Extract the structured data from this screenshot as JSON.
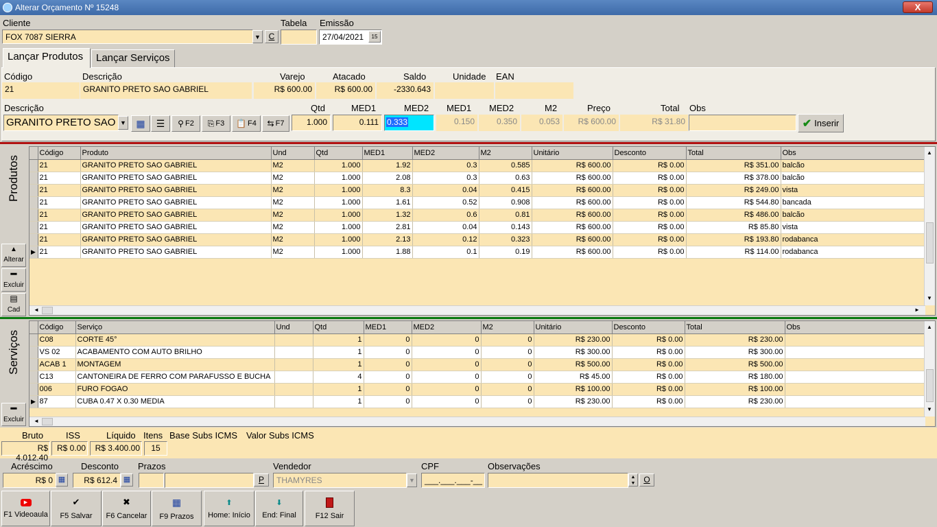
{
  "window": {
    "title": "Alterar Orçamento Nº 15248",
    "close_label": "X"
  },
  "header": {
    "cliente_label": "Cliente",
    "cliente_value": "FOX 7087 SIERRA",
    "c_btn": "C",
    "tabela_label": "Tabela",
    "tabela_value": "",
    "emissao_label": "Emissão",
    "emissao_value": "27/04/2021",
    "cal_btn": "15"
  },
  "tabs": {
    "produtos": "Lançar Produtos",
    "servicos": "Lançar Serviços"
  },
  "product_info": {
    "codigo_label": "Código",
    "codigo": "21",
    "descricao_label": "Descrição",
    "descricao": "GRANITO PRETO SAO GABRIEL",
    "varejo_label": "Varejo",
    "varejo": "R$ 600.00",
    "atacado_label": "Atacado",
    "atacado": "R$ 600.00",
    "saldo_label": "Saldo",
    "saldo": "-2330.643",
    "unidade_label": "Unidade",
    "unidade": "",
    "ean_label": "EAN",
    "ean": ""
  },
  "entry": {
    "descricao_label": "Descrição",
    "descricao_value": "GRANITO PRETO SAO",
    "f2": "F2",
    "f3": "F3",
    "f4": "F4",
    "f7": "F7",
    "qtd_label": "Qtd",
    "qtd": "1.000",
    "med1_label": "MED1",
    "med1": "0.111",
    "med2_label": "MED2",
    "med2": "0.333",
    "rmed1_label": "MED1",
    "rmed1": "0.150",
    "rmed2_label": "MED2",
    "rmed2": "0.350",
    "m2_label": "M2",
    "m2": "0.053",
    "preco_label": "Preço",
    "preco": "R$ 600.00",
    "total_label": "Total",
    "total": "R$ 31.80",
    "obs_label": "Obs",
    "obs": "",
    "inserir": "Inserir"
  },
  "produtos": {
    "side_title": "Produtos",
    "alterar": "Alterar",
    "excluir": "Excluir",
    "cad": "Cad",
    "columns": [
      "Código",
      "Produto",
      "Und",
      "Qtd",
      "MED1",
      "MED2",
      "M2",
      "Unitário",
      "Desconto",
      "Total",
      "Obs"
    ],
    "rows": [
      [
        "21",
        "GRANITO PRETO SAO GABRIEL",
        "M2",
        "1.000",
        "1.92",
        "0.3",
        "0.585",
        "R$ 600.00",
        "R$ 0.00",
        "R$ 351.00",
        "balcão"
      ],
      [
        "21",
        "GRANITO PRETO SAO GABRIEL",
        "M2",
        "1.000",
        "2.08",
        "0.3",
        "0.63",
        "R$ 600.00",
        "R$ 0.00",
        "R$ 378.00",
        "balcão"
      ],
      [
        "21",
        "GRANITO PRETO SAO GABRIEL",
        "M2",
        "1.000",
        "8.3",
        "0.04",
        "0.415",
        "R$ 600.00",
        "R$ 0.00",
        "R$ 249.00",
        "vista"
      ],
      [
        "21",
        "GRANITO PRETO SAO GABRIEL",
        "M2",
        "1.000",
        "1.61",
        "0.52",
        "0.908",
        "R$ 600.00",
        "R$ 0.00",
        "R$ 544.80",
        "bancada"
      ],
      [
        "21",
        "GRANITO PRETO SAO GABRIEL",
        "M2",
        "1.000",
        "1.32",
        "0.6",
        "0.81",
        "R$ 600.00",
        "R$ 0.00",
        "R$ 486.00",
        "balcão"
      ],
      [
        "21",
        "GRANITO PRETO SAO GABRIEL",
        "M2",
        "1.000",
        "2.81",
        "0.04",
        "0.143",
        "R$ 600.00",
        "R$ 0.00",
        "R$ 85.80",
        "vista"
      ],
      [
        "21",
        "GRANITO PRETO SAO GABRIEL",
        "M2",
        "1.000",
        "2.13",
        "0.12",
        "0.323",
        "R$ 600.00",
        "R$ 0.00",
        "R$ 193.80",
        "rodabanca"
      ],
      [
        "21",
        "GRANITO PRETO SAO GABRIEL",
        "M2",
        "1.000",
        "1.88",
        "0.1",
        "0.19",
        "R$ 600.00",
        "R$ 0.00",
        "R$ 114.00",
        "rodabanca"
      ]
    ]
  },
  "servicos": {
    "side_title": "Serviços",
    "excluir": "Excluir",
    "columns": [
      "Código",
      "Serviço",
      "Und",
      "Qtd",
      "MED1",
      "MED2",
      "M2",
      "Unitário",
      "Desconto",
      "Total",
      "Obs"
    ],
    "rows": [
      [
        "C08",
        "CORTE 45°",
        "",
        "1",
        "0",
        "0",
        "0",
        "R$ 230.00",
        "R$ 0.00",
        "R$ 230.00",
        ""
      ],
      [
        "VS 02",
        "ACABAMENTO COM AUTO BRILHO",
        "",
        "1",
        "0",
        "0",
        "0",
        "R$ 300.00",
        "R$ 0.00",
        "R$ 300.00",
        ""
      ],
      [
        "ACAB 1",
        "MONTAGEM",
        "",
        "1",
        "0",
        "0",
        "0",
        "R$ 500.00",
        "R$ 0.00",
        "R$ 500.00",
        ""
      ],
      [
        "C13",
        "CANTONEIRA DE FERRO COM PARAFUSSO E BUCHA",
        "",
        "4",
        "0",
        "0",
        "0",
        "R$ 45.00",
        "R$ 0.00",
        "R$ 180.00",
        ""
      ],
      [
        "006",
        "FURO FOGAO",
        "",
        "1",
        "0",
        "0",
        "0",
        "R$ 100.00",
        "R$ 0.00",
        "R$ 100.00",
        ""
      ],
      [
        "87",
        "CUBA 0.47 X 0.30 MEDIA",
        "",
        "1",
        "0",
        "0",
        "0",
        "R$ 230.00",
        "R$ 0.00",
        "R$ 230.00",
        ""
      ]
    ]
  },
  "totals": {
    "bruto_label": "Bruto",
    "bruto": "R$ 4.012.40",
    "iss_label": "ISS",
    "iss": "R$ 0.00",
    "liquido_label": "Líquido",
    "liquido": "R$ 3.400.00",
    "itens_label": "Itens",
    "itens": "15",
    "base_label": "Base Subs ICMS",
    "valor_label": "Valor Subs ICMS"
  },
  "footer_fields": {
    "acrescimo_label": "Acréscimo",
    "acrescimo": "R$ 0",
    "desconto_label": "Desconto",
    "desconto": "R$ 612.4",
    "prazos_label": "Prazos",
    "prazos_btn": "P",
    "vendedor_label": "Vendedor",
    "vendedor": "THAMYRES",
    "cpf_label": "CPF",
    "cpf": "___.___.___-__",
    "obs_label": "Observações",
    "obs_btn": "O"
  },
  "bottom_buttons": {
    "videoaula": "F1 Videoaula",
    "salvar": "F5 Salvar",
    "cancelar": "F6 Cancelar",
    "prazos": "F9 Prazos",
    "inicio": "Home: Início",
    "final": "End: Final",
    "sair": "F12 Sair"
  },
  "colors": {
    "field_bg": "#fbe6b4",
    "titlebar": "#4a78b6",
    "red_sep": "#b01010",
    "green_sep": "#0a7a10",
    "highlight": "#1e90ff"
  }
}
